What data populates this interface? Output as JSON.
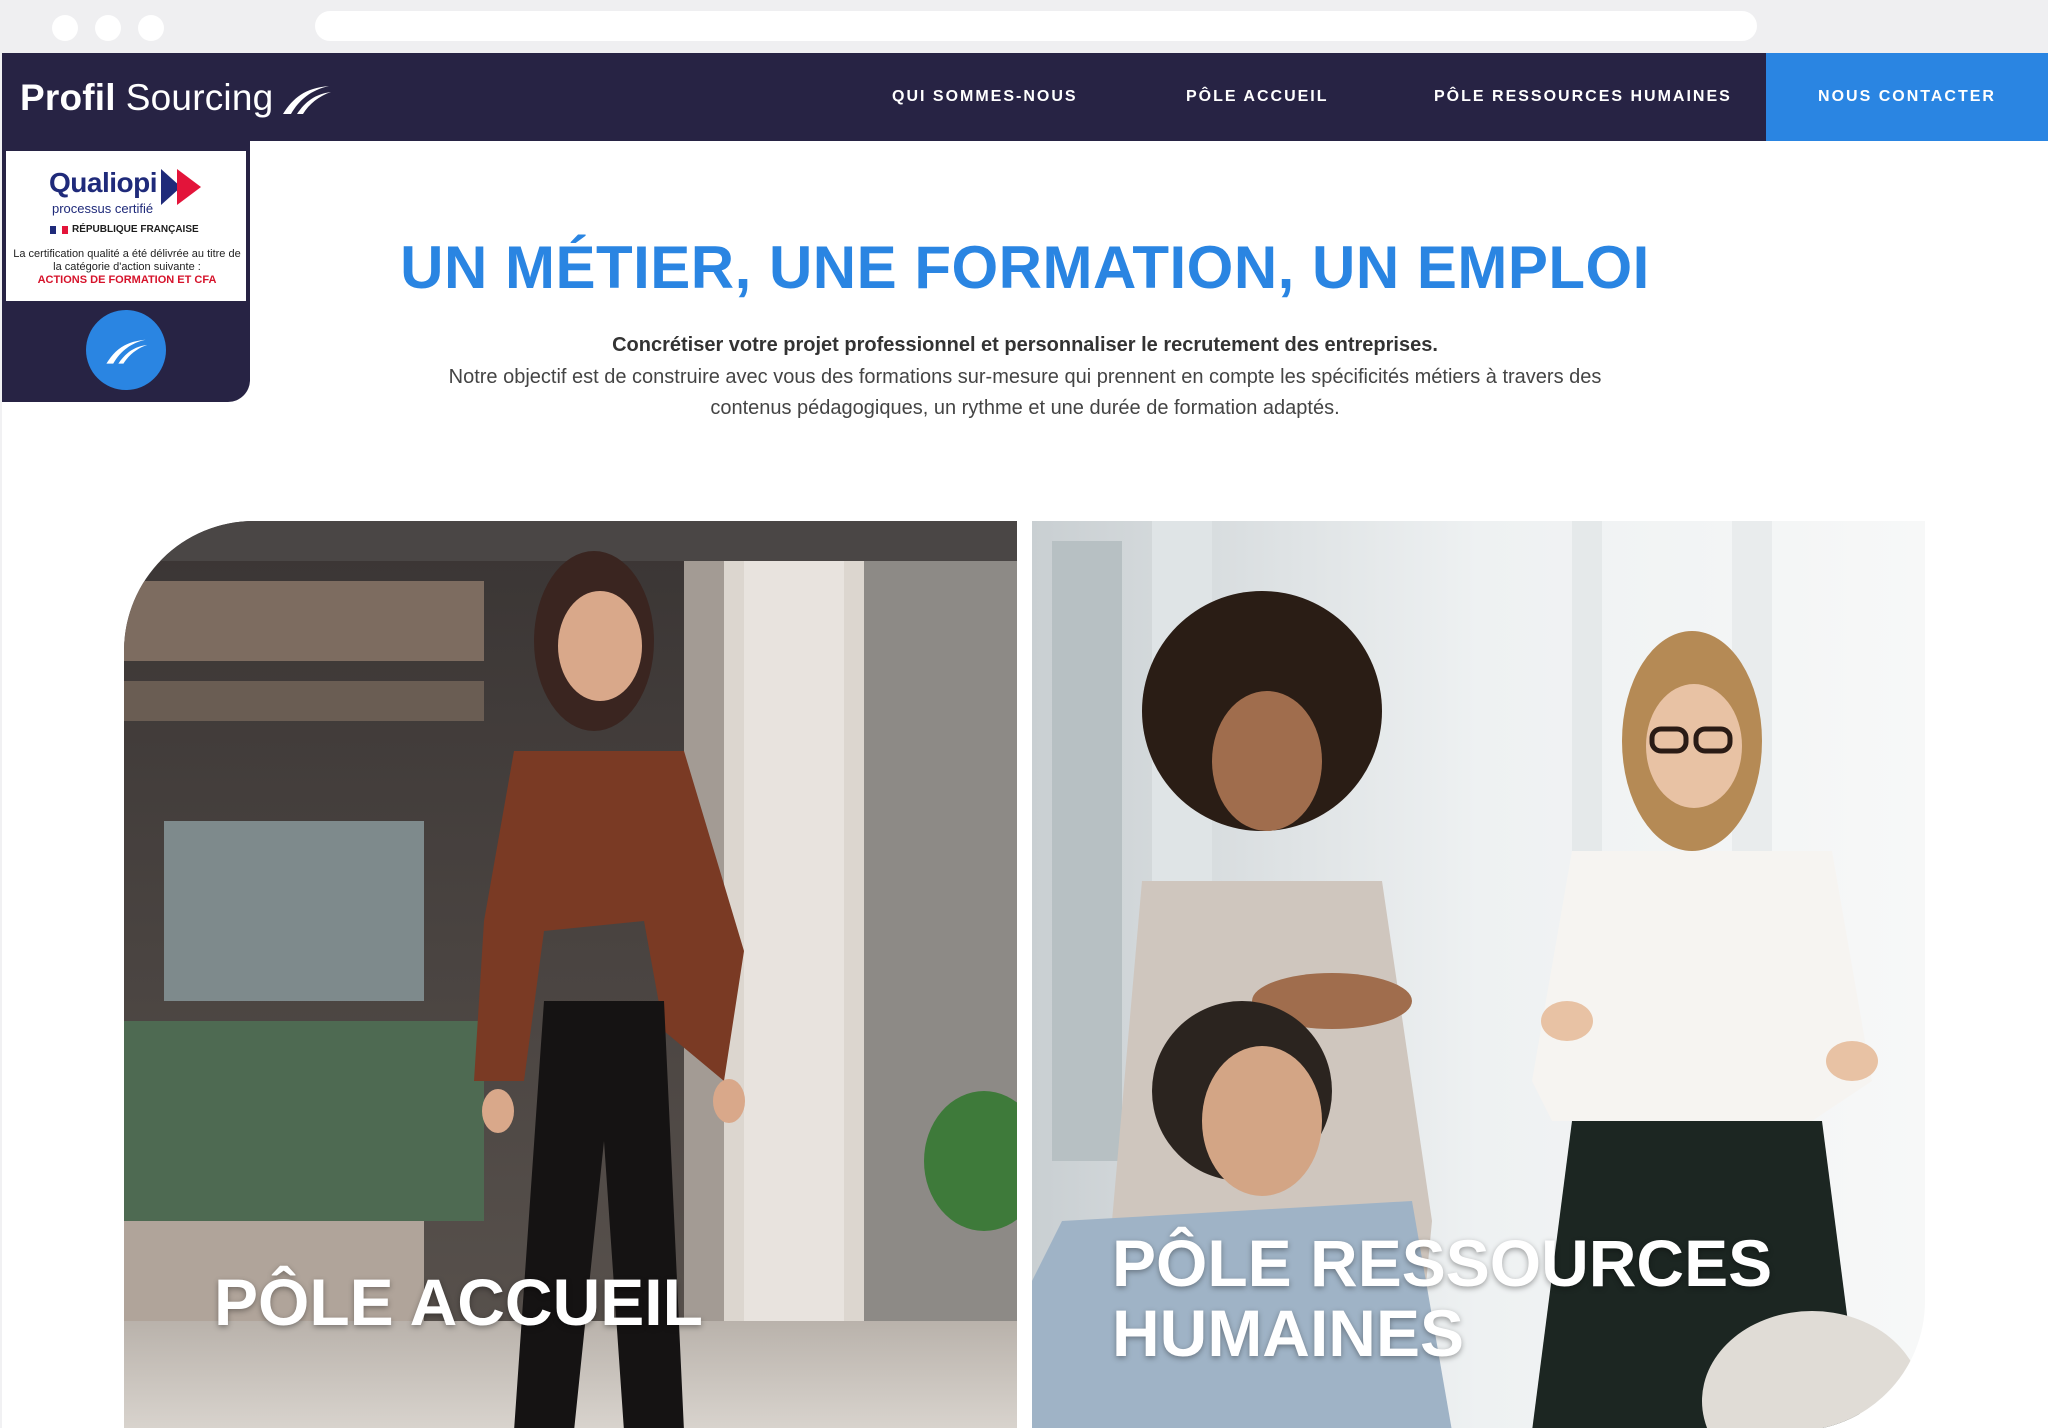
{
  "brand": {
    "name_bold": "Profil",
    "name_regular": "Sourcing"
  },
  "nav": {
    "items": [
      "QUI SOMMES-NOUS",
      "PÔLE ACCUEIL",
      "PÔLE RESSOURCES HUMAINES"
    ],
    "contact": "NOUS CONTACTER"
  },
  "qualiopi": {
    "title": "Qualiopi",
    "subtitle": "processus certifié",
    "republic": "RÉPUBLIQUE FRANÇAISE",
    "text": "La certification qualité a été délivrée au titre de la catégorie d'action suivante :",
    "category": "ACTIONS DE FORMATION ET CFA"
  },
  "intro": {
    "headline": "UN MÉTIER, UNE FORMATION, UN EMPLOI",
    "lead": "Concrétiser votre projet professionnel et personnaliser le recrutement des entreprises.",
    "description": "Notre objectif est de construire avec vous des formations sur-mesure qui prennent en compte les spécificités métiers à travers des contenus pédagogiques, un rythme et une durée de formation adaptés."
  },
  "cards": [
    {
      "label": "PÔLE ACCUEIL",
      "image": "woman-walking-office-photo"
    },
    {
      "label": "PÔLE RESSOURCES HUMAINES",
      "image": "team-meeting-photo"
    }
  ],
  "colors": {
    "navy": "#272344",
    "accent": "#2a85e2",
    "text": "#444444"
  }
}
